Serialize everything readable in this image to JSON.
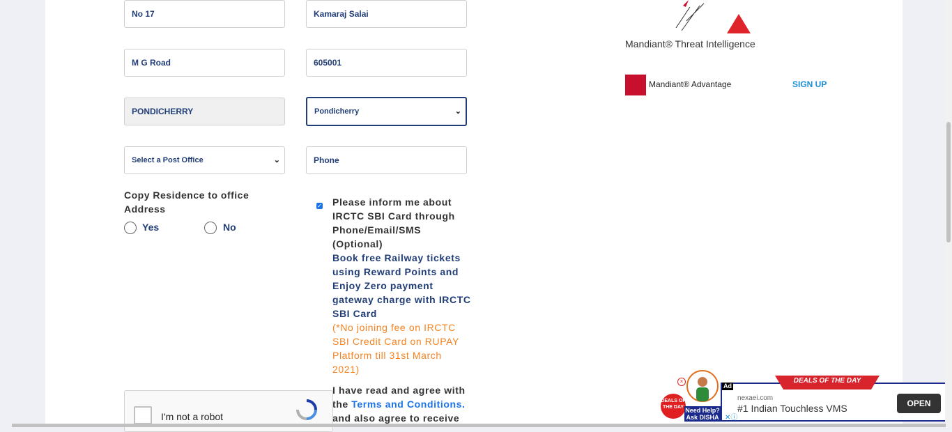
{
  "form": {
    "address1": "No 17",
    "address2": "Kamaraj Salai",
    "address3": "M G Road",
    "pincode": "605001",
    "city": "PONDICHERRY",
    "state_select": "Pondicherry",
    "post_office_select": "Select a Post Office",
    "phone_placeholder": "Phone",
    "copy_residence_label": "Copy Residence to office Address",
    "yes_label": "Yes",
    "no_label": "No",
    "inform_text": "Please inform me about IRCTC SBI Card through Phone/Email/SMS (Optional)",
    "book_free_text": "Book free Railway tickets using Reward Points and Enjoy Zero payment gateway charge with IRCTC SBI Card",
    "no_fee_text": "(*No joining fee on IRCTC SBI Credit Card on RUPAY Platform till 31st March 2021)",
    "agree_prefix": "I have read and agree with the ",
    "terms_link": "Terms and Conditions.",
    "agree_suffix": " and also agree to receive",
    "captcha_label": "I'm not a robot"
  },
  "sidebar": {
    "title": "Mandiant® Threat Intelligence",
    "brand": "Mandiant® Advantage",
    "signup": "SIGN UP"
  },
  "ad": {
    "tag": "Ad",
    "banner": "DEALS OF THE DAY",
    "domain": "nexaei.com",
    "headline": "#1 Indian Touchless VMS",
    "open_button": "OPEN",
    "disha_help": "Need Help? Ask DISHA",
    "deals_badge": "DEALS OF THE DAY"
  }
}
